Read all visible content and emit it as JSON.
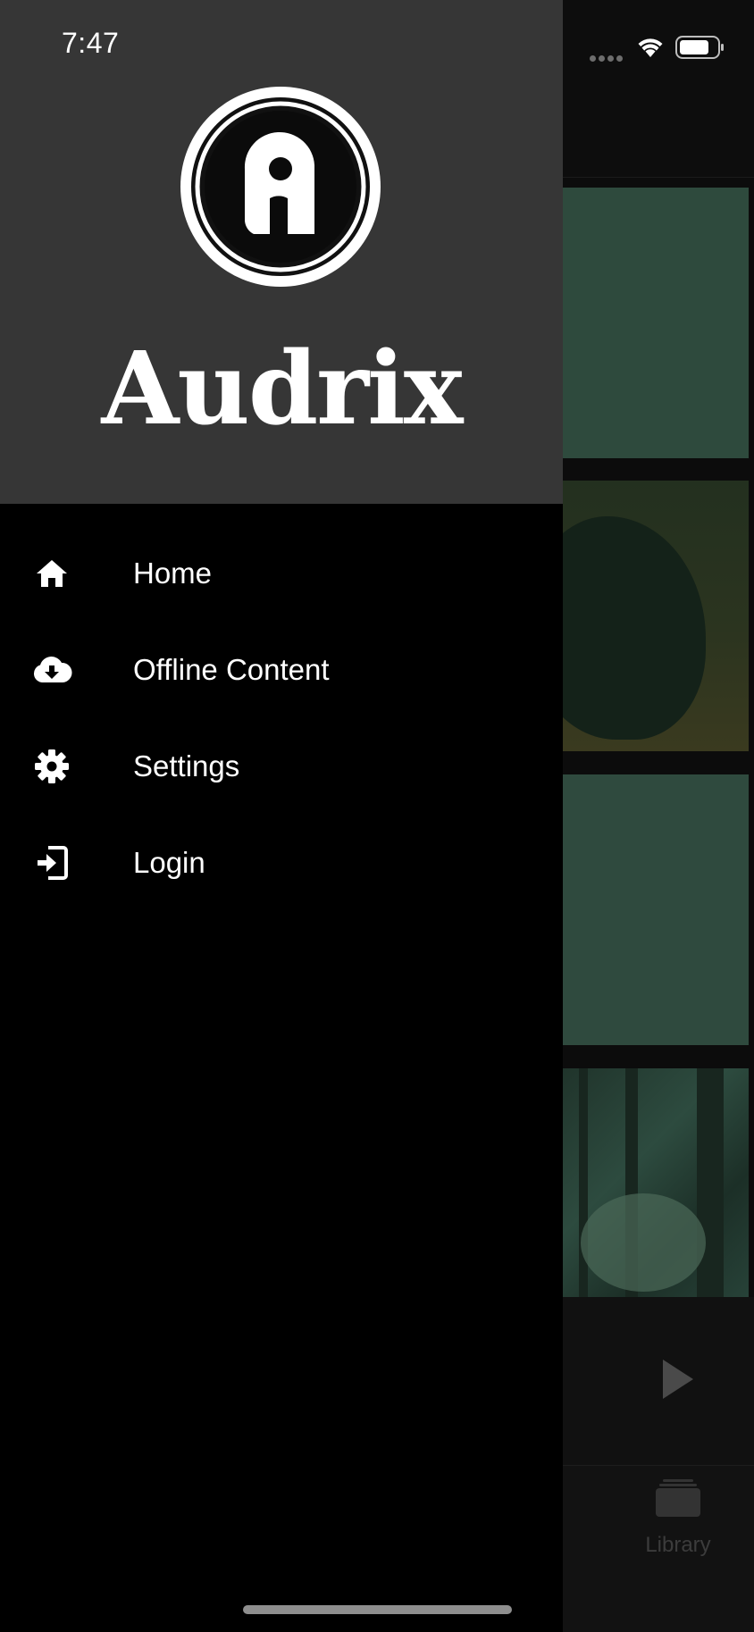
{
  "status_bar": {
    "time": "7:47"
  },
  "drawer": {
    "brand_name": "Audrix",
    "logo_letter": "a",
    "menu_items": [
      {
        "label": "Home",
        "icon": "home-icon"
      },
      {
        "label": "Offline Content",
        "icon": "cloud-download-icon"
      },
      {
        "label": "Settings",
        "icon": "gear-icon"
      },
      {
        "label": "Login",
        "icon": "login-icon"
      }
    ]
  },
  "background_app": {
    "tabbar": {
      "library_label": "Library"
    }
  },
  "colors": {
    "drawer_header_bg": "#363636",
    "drawer_bg": "#000000",
    "text": "#ffffff",
    "card_green": "#2e4a3d"
  }
}
